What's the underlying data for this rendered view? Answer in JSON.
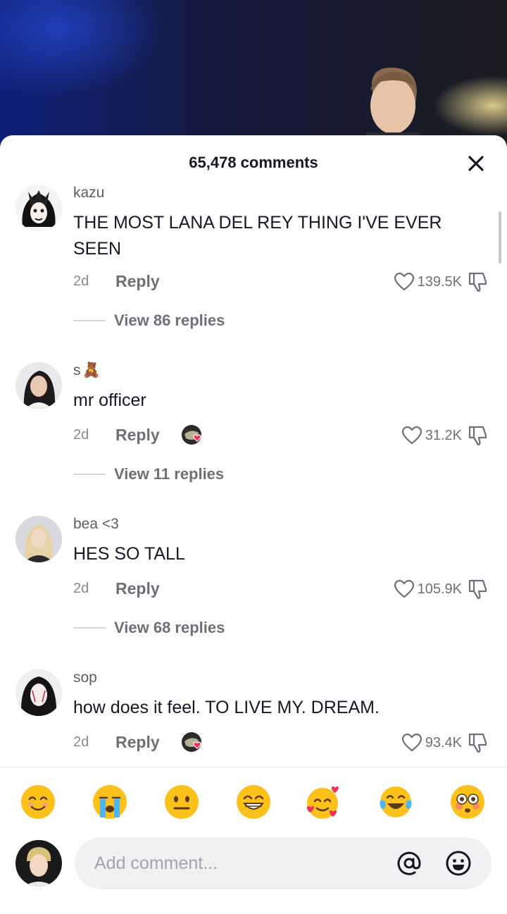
{
  "sheet": {
    "title": "65,478 comments",
    "close_icon": "close-icon"
  },
  "comments": [
    {
      "username": "kazu",
      "text": "THE MOST LANA DEL REY THING I'VE EVER SEEN",
      "time": "2d",
      "reply_label": "Reply",
      "likes": "139.5K",
      "creator_liked": false,
      "view_replies": "View 86 replies"
    },
    {
      "username": "s",
      "username_emoji": "🧸",
      "text": "mr officer",
      "time": "2d",
      "reply_label": "Reply",
      "likes": "31.2K",
      "creator_liked": true,
      "view_replies": "View 11 replies"
    },
    {
      "username": "bea <3",
      "text": "HES SO TALL",
      "time": "2d",
      "reply_label": "Reply",
      "likes": "105.9K",
      "creator_liked": false,
      "view_replies": "View 68 replies"
    },
    {
      "username": "sop",
      "text": "how does it feel. TO LIVE MY. DREAM.",
      "time": "2d",
      "reply_label": "Reply",
      "likes": "93.4K",
      "creator_liked": true
    }
  ],
  "emoji_bar": [
    "smiling-face",
    "loudly-crying-face",
    "neutral-face",
    "grinning-face",
    "smiling-face-with-hearts",
    "tears-of-joy-face",
    "flushed-face"
  ],
  "composer": {
    "placeholder": "Add comment...",
    "value": "",
    "mention_icon": "at-sign-icon",
    "emoji_icon": "emoji-icon"
  },
  "colors": {
    "text_primary": "#161823",
    "text_secondary": "#6f7077",
    "input_bg": "#f1f1f3",
    "sheet_bg": "#ffffff"
  }
}
